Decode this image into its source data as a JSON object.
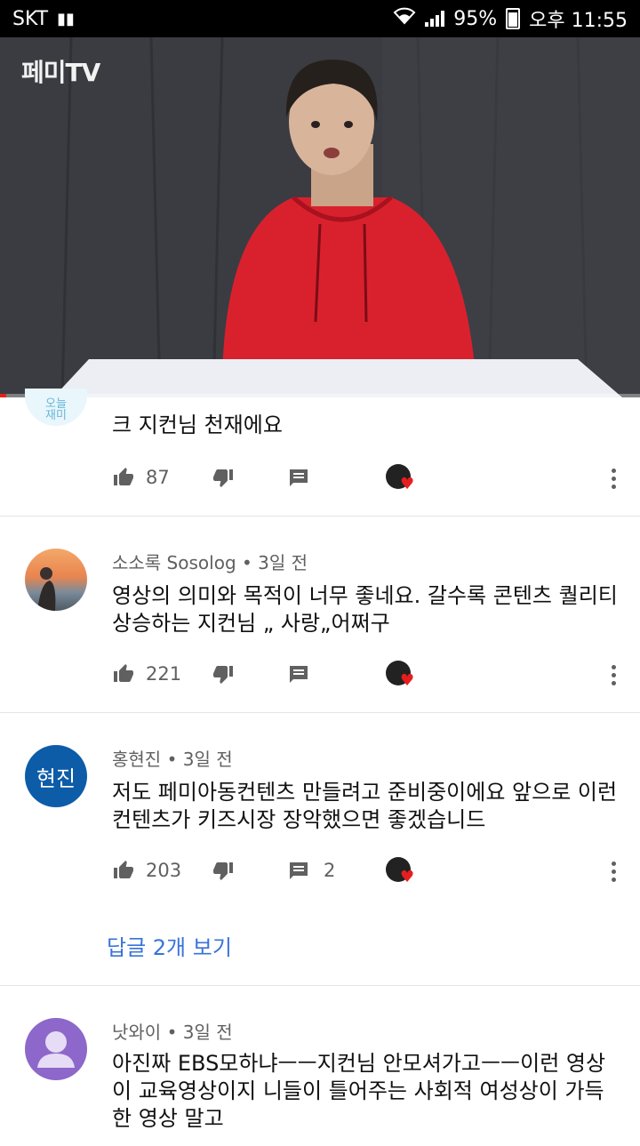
{
  "status_bar": {
    "carrier": "SKT",
    "battery": "95%",
    "time": "오후 11:55"
  },
  "video": {
    "channel_logo": "페미TV",
    "progress": 0.01
  },
  "comments": [
    {
      "author": "",
      "time": "",
      "text": "크 지컨님 천재에요",
      "likes": "87",
      "replies_count": "",
      "avatar_text": "오늘\n재미",
      "hearted": true
    },
    {
      "author": "소소록 Sosolog",
      "time": "3일 전",
      "text": "영상의 의미와 목적이 너무 좋네요. 갈수록 콘텐츠 퀄리티 상승하는 지컨님 „ 사랑„어쩌구",
      "likes": "221",
      "replies_count": "",
      "hearted": true
    },
    {
      "author": "홍현진",
      "time": "3일 전",
      "text": "저도 페미아동컨텐츠 만들려고 준비중이에요 앞으로 이런 컨텐츠가 키즈시장 장악했으면 좋겠습니드",
      "likes": "203",
      "replies_count": "2",
      "avatar_text": "현진",
      "hearted": true,
      "view_replies": "답글 2개 보기"
    },
    {
      "author": "낫와이",
      "time": "3일 전",
      "text": "아진짜 EBS모하냐ㅡㅡ지컨님 안모셔가고ㅡㅡ이런 영상이 교육영상이지 니들이 틀어주는 사회적 여성상이 가득한 영상 말고"
    }
  ],
  "colors": {
    "accent_blue": "#3873d9",
    "heart": "#e61e1e",
    "avatar_blue": "#0d5ca8",
    "avatar_purple": "#8d67c9"
  }
}
